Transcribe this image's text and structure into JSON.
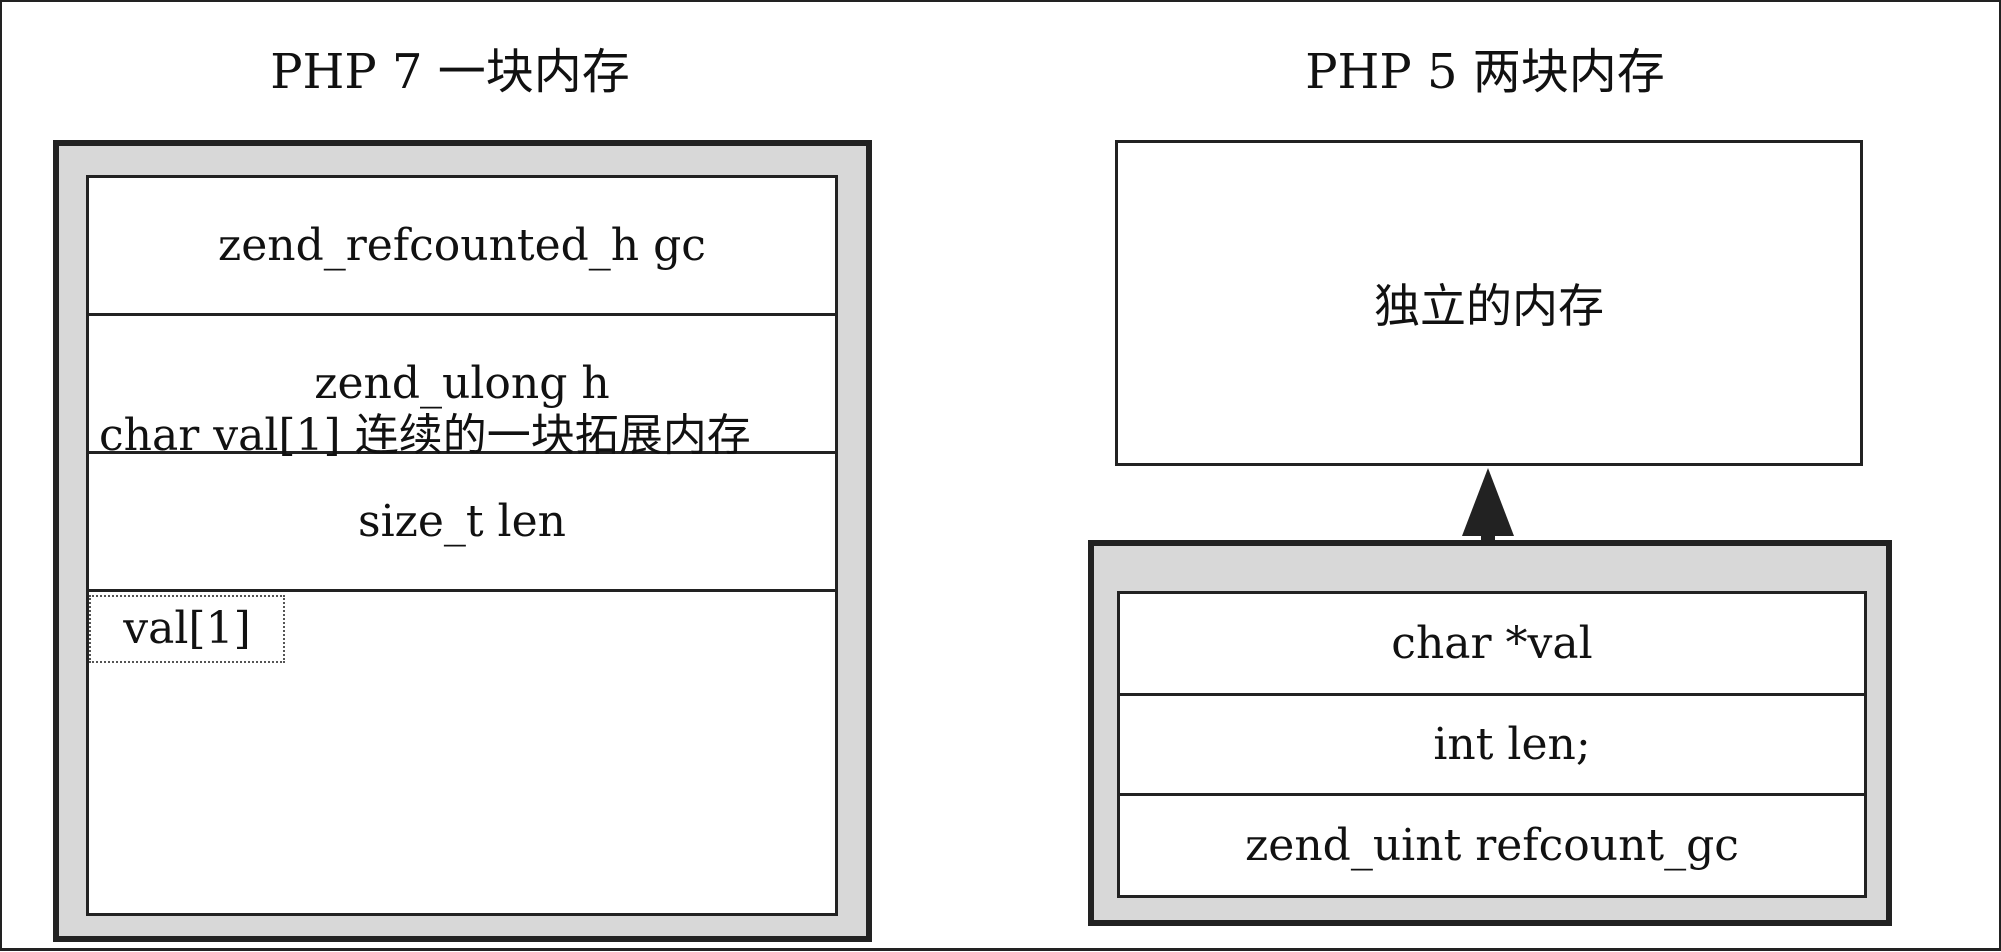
{
  "left": {
    "title": "PHP 7 一块内存",
    "rows": [
      "zend_refcounted_h gc",
      "zend_ulong h",
      "size_t len"
    ],
    "val_label": "val[1]",
    "extension_label": "char val[1] 连续的一块拓展内存"
  },
  "right": {
    "title": "PHP 5 两块内存",
    "top_box_label": "独立的内存",
    "rows": [
      "char *val",
      "int len;",
      "zend_uint refcount_gc"
    ]
  }
}
